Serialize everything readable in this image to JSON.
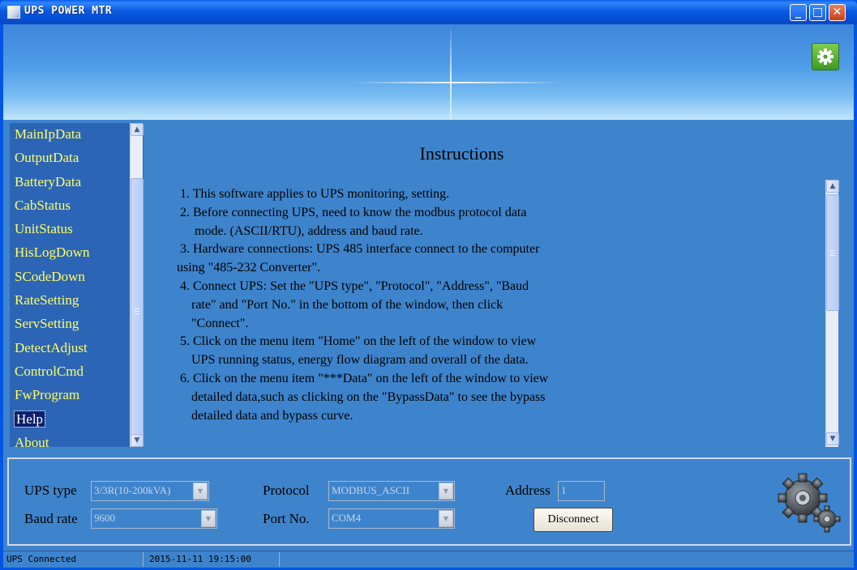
{
  "window": {
    "title": "UPS POWER MTR",
    "controls": {
      "minimize": "_",
      "maximize": "□",
      "close": "✕"
    }
  },
  "banner": {
    "settings_icon": "gear-icon"
  },
  "sidebar": {
    "items": [
      {
        "label": "MainIpData"
      },
      {
        "label": "OutputData"
      },
      {
        "label": "BatteryData"
      },
      {
        "label": "CabStatus"
      },
      {
        "label": "UnitStatus"
      },
      {
        "label": "HisLogDown"
      },
      {
        "label": "SCodeDown"
      },
      {
        "label": "RateSetting"
      },
      {
        "label": "ServSetting"
      },
      {
        "label": "DetectAdjust"
      },
      {
        "label": "ControlCmd"
      },
      {
        "label": "FwProgram"
      },
      {
        "label": "Help"
      },
      {
        "label": "About"
      }
    ],
    "selected": "Help"
  },
  "content": {
    "heading": "Instructions",
    "lines": [
      "1. This software applies to UPS monitoring, setting.",
      "2. Before connecting UPS, need to know the modbus protocol data",
      "mode. (ASCII/RTU), address and baud rate.",
      "3. Hardware connections: UPS 485 interface connect to the computer",
      "using \"485-232 Converter\".",
      "4. Connect UPS: Set the \"UPS type\", \"Protocol\", \"Address\", \"Baud",
      "rate\" and \"Port No.\" in the bottom of the window, then click",
      "\"Connect\".",
      "5. Click on the menu item \"Home\" on the left of the window to view",
      "UPS running status, energy flow diagram and overall of the data.",
      "6. Click on the menu item \"***Data\" on the left of the window to view",
      "detailed data,such as clicking on the \"BypassData\" to see the bypass",
      "detailed data and bypass curve."
    ]
  },
  "settings": {
    "ups_type_label": "UPS type",
    "ups_type_value": "3/3R(10-200kVA)",
    "protocol_label": "Protocol",
    "protocol_value": "MODBUS_ASCII",
    "address_label": "Address",
    "address_value": "1",
    "baud_rate_label": "Baud rate",
    "baud_rate_value": "9600",
    "port_label": "Port No.",
    "port_value": "COM4",
    "disconnect_label": "Disconnect"
  },
  "status": {
    "connection": "UPS Connected",
    "datetime": "2015-11-11 19:15:00"
  }
}
